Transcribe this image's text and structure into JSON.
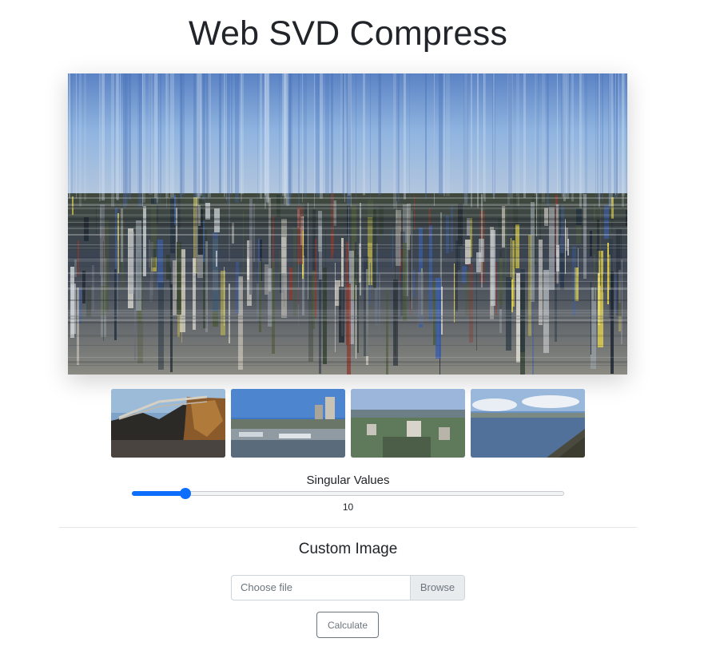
{
  "page": {
    "title": "Web SVD Compress"
  },
  "thumbnails": [
    {
      "icon": "bridge-photo"
    },
    {
      "icon": "waterfront-city-photo"
    },
    {
      "icon": "city-overview-photo"
    },
    {
      "icon": "bay-shoreline-photo"
    }
  ],
  "singular_values": {
    "label": "Singular Values",
    "value": "10",
    "slider_fraction": 0.068
  },
  "custom_image": {
    "heading": "Custom Image",
    "file_placeholder": "Choose file",
    "browse_label": "Browse",
    "calculate_label": "Calculate"
  },
  "colors": {
    "accent": "#0d6efd",
    "text": "#212529",
    "muted": "#6c757d"
  }
}
